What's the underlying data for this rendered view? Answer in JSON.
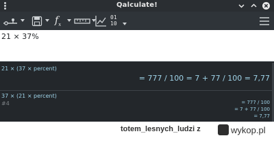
{
  "window": {
    "title": "Qalculate!"
  },
  "toolbar": {
    "items": [
      "mode-icon",
      "save-icon",
      "functions-icon",
      "units-icon",
      "plot-icon",
      "number-bases-icon",
      "menu-icon"
    ],
    "func_label": "f",
    "func_sub": "x",
    "base_top": "01",
    "base_bottom": "10"
  },
  "input": {
    "expression": "21 × 37%"
  },
  "history": [
    {
      "expression": "21 × (37 × percent)",
      "result": "= 777 / 100 = 7 + 77 / 100 = 7,77"
    },
    {
      "expression": "37 × (21 × percent)",
      "index": "#4",
      "result_lines": [
        "= 777 / 100",
        "= 7 + 77 / 100",
        "= 7,77"
      ]
    }
  ],
  "watermark": {
    "author": "totem_lesnych_ludzi z",
    "site": "wykop.pl"
  }
}
